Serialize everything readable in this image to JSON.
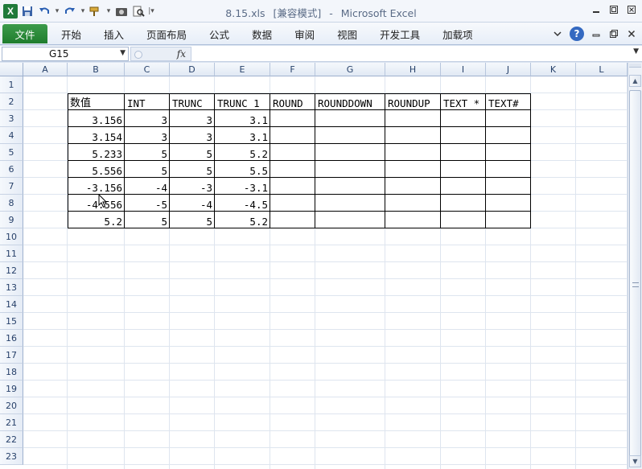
{
  "window": {
    "title_file": "8.15.xls",
    "title_mode": "[兼容模式]",
    "title_sep": "-",
    "title_app": "Microsoft Excel"
  },
  "quick_access": {
    "icons": [
      "excel-logo",
      "save-icon",
      "undo-icon",
      "redo-icon",
      "format-painter-icon",
      "camera-icon",
      "print-preview-icon",
      "customize-icon"
    ]
  },
  "ribbon": {
    "file_tab": "文件",
    "tabs": [
      "开始",
      "插入",
      "页面布局",
      "公式",
      "数据",
      "审阅",
      "视图",
      "开发工具",
      "加载项"
    ]
  },
  "formula_bar": {
    "name_box": "G15",
    "fx_label": "fx",
    "formula": ""
  },
  "sheet": {
    "columns": [
      "A",
      "B",
      "C",
      "D",
      "E",
      "F",
      "G",
      "H",
      "I",
      "J",
      "K",
      "L"
    ],
    "rows": [
      "1",
      "2",
      "3",
      "4",
      "5",
      "6",
      "7",
      "8",
      "9",
      "10",
      "11",
      "12",
      "13",
      "14",
      "15",
      "16",
      "17",
      "18",
      "19",
      "20",
      "21",
      "22",
      "23"
    ],
    "table": {
      "headers": [
        "数值",
        "INT",
        "TRUNC",
        "TRUNC 1",
        "ROUND",
        "ROUNDDOWN",
        "ROUNDUP",
        "TEXT *",
        "TEXT#"
      ],
      "rows": [
        [
          "3.156",
          "3",
          "3",
          "3.1",
          "",
          "",
          "",
          "",
          ""
        ],
        [
          "3.154",
          "3",
          "3",
          "3.1",
          "",
          "",
          "",
          "",
          ""
        ],
        [
          "5.233",
          "5",
          "5",
          "5.2",
          "",
          "",
          "",
          "",
          ""
        ],
        [
          "5.556",
          "5",
          "5",
          "5.5",
          "",
          "",
          "",
          "",
          ""
        ],
        [
          "-3.156",
          "-4",
          "-3",
          "-3.1",
          "",
          "",
          "",
          "",
          ""
        ],
        [
          "-4.556",
          "-5",
          "-4",
          "-4.5",
          "",
          "",
          "",
          "",
          ""
        ],
        [
          "5.2",
          "5",
          "5",
          "5.2",
          "",
          "",
          "",
          "",
          ""
        ]
      ]
    }
  },
  "colors": {
    "file_tab": "#1f7d2d",
    "help": "#3469c1",
    "header_text": "#27416a"
  }
}
